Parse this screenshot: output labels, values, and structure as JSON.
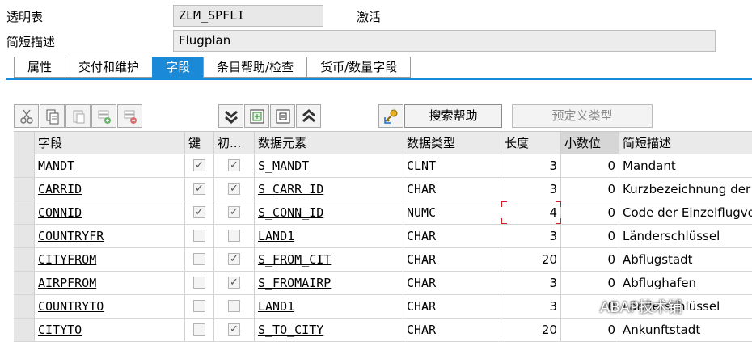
{
  "header": {
    "object_type": "透明表",
    "table_name": "ZLM_SPFLI",
    "status": "激活",
    "short_desc_label": "简短描述",
    "short_desc_value": "Flugplan"
  },
  "tabs": [
    {
      "label": "属性",
      "active": false
    },
    {
      "label": "交付和维护",
      "active": false
    },
    {
      "label": "字段",
      "active": true
    },
    {
      "label": "条目帮助/检查",
      "active": false
    },
    {
      "label": "货币/数量字段",
      "active": false
    }
  ],
  "toolbar": {
    "icons": [
      "cut-icon",
      "copy-icon",
      "paste-icon",
      "insert-row-icon",
      "delete-row-icon",
      "collapse-icon",
      "expand-details-icon",
      "details-icon",
      "expand-icon",
      "search-help-key-icon"
    ],
    "search_help_label": "搜索帮助",
    "predefined_type_label": "预定义类型"
  },
  "table": {
    "columns": [
      "字段",
      "键",
      "初...",
      "数据元素",
      "数据类型",
      "长度",
      "小数位",
      "简短描述"
    ],
    "rows": [
      {
        "field": "MANDT",
        "key": true,
        "init": true,
        "element": "S_MANDT",
        "type": "CLNT",
        "length": "3",
        "decimals": "0",
        "desc": "Mandant"
      },
      {
        "field": "CARRID",
        "key": true,
        "init": true,
        "element": "S_CARR_ID",
        "type": "CHAR",
        "length": "3",
        "decimals": "0",
        "desc": "Kurzbezeichnung der F"
      },
      {
        "field": "CONNID",
        "key": true,
        "init": true,
        "element": "S_CONN_ID",
        "type": "NUMC",
        "length": "4",
        "decimals": "0",
        "desc": "Code der Einzelflugver"
      },
      {
        "field": "COUNTRYFR",
        "key": false,
        "init": false,
        "element": "LAND1",
        "type": "CHAR",
        "length": "3",
        "decimals": "0",
        "desc": "Länderschlüssel"
      },
      {
        "field": "CITYFROM",
        "key": false,
        "init": true,
        "element": "S_FROM_CIT",
        "type": "CHAR",
        "length": "20",
        "decimals": "0",
        "desc": "Abflugstadt"
      },
      {
        "field": "AIRPFROM",
        "key": false,
        "init": true,
        "element": "S_FROMAIRP",
        "type": "CHAR",
        "length": "3",
        "decimals": "0",
        "desc": "Abflughafen"
      },
      {
        "field": "COUNTRYTO",
        "key": false,
        "init": false,
        "element": "LAND1",
        "type": "CHAR",
        "length": "3",
        "decimals": "0",
        "desc": "Länderschlüssel"
      },
      {
        "field": "CITYTO",
        "key": false,
        "init": true,
        "element": "S_TO_CITY",
        "type": "CHAR",
        "length": "20",
        "decimals": "0",
        "desc": "Ankunftstadt"
      }
    ]
  },
  "watermark": "ABAP技术铺",
  "colors": {
    "accent": "#1a8ad8",
    "focus": "#d02020"
  }
}
